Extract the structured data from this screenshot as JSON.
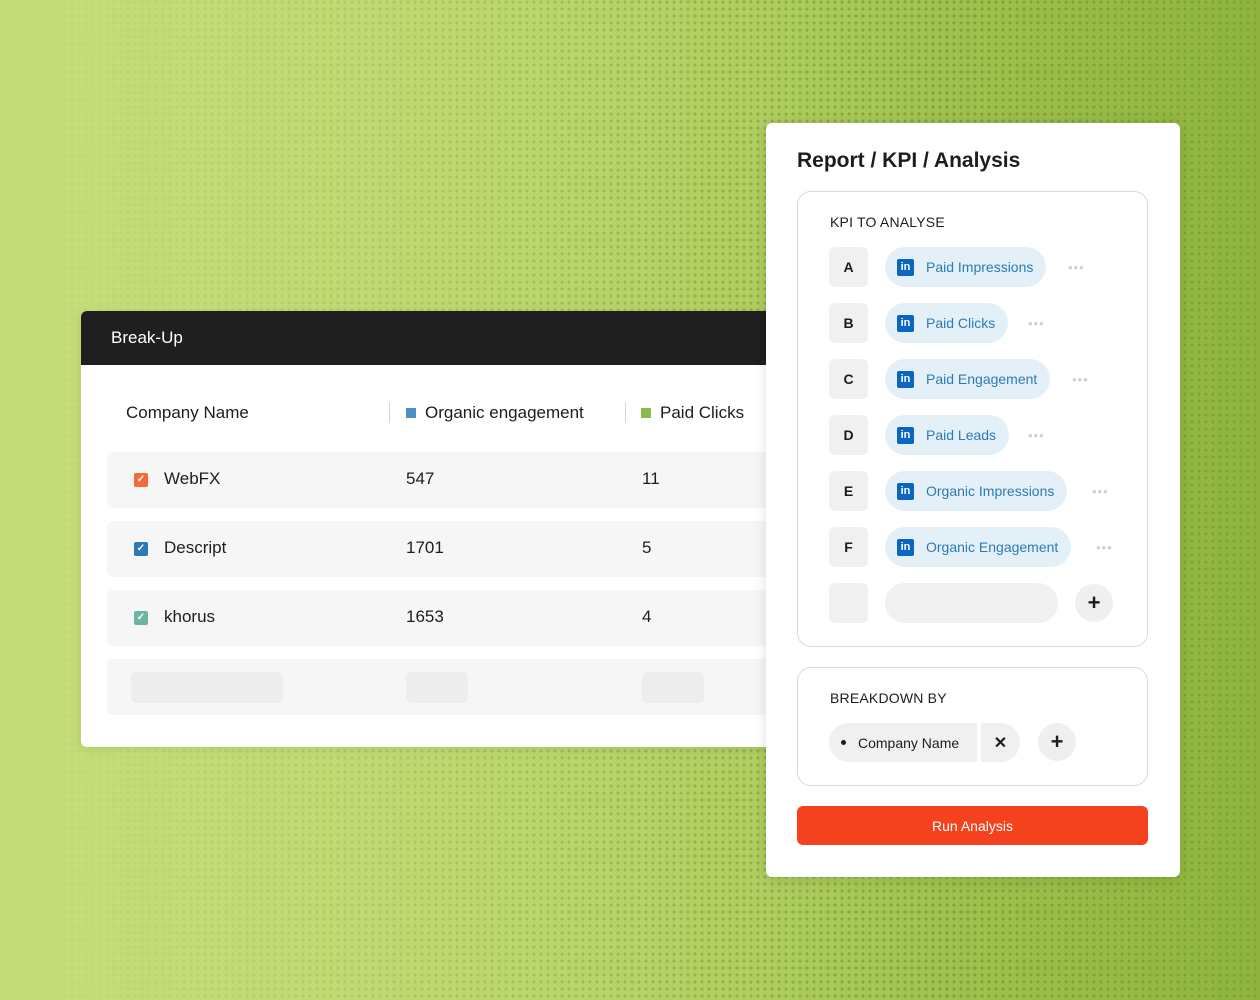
{
  "breakup": {
    "title": "Break-Up",
    "columns": [
      {
        "label": "Company Name",
        "color": ""
      },
      {
        "label": "Organic engagement",
        "color": "#4a90c2"
      },
      {
        "label": "Paid Clicks",
        "color": "#8db84a"
      }
    ],
    "rows": [
      {
        "company": "WebFX",
        "organic": "547",
        "paid_clicks": "11",
        "checkbox_color": "#f26b3a",
        "checked": true
      },
      {
        "company": "Descript",
        "organic": "1701",
        "paid_clicks": "5",
        "checkbox_color": "#2e79b3",
        "checked": true
      },
      {
        "company": "khorus",
        "organic": "1653",
        "paid_clicks": "4",
        "checkbox_color": "#6fb3a3",
        "checked": true
      }
    ]
  },
  "report": {
    "title": "Report / KPI / Analysis",
    "kpi_label": "KPI TO ANALYSE",
    "kpis": [
      {
        "letter": "A",
        "label": "Paid Impressions",
        "icon": "linkedin-icon"
      },
      {
        "letter": "B",
        "label": "Paid Clicks",
        "icon": "linkedin-icon"
      },
      {
        "letter": "C",
        "label": "Paid Engagement",
        "icon": "linkedin-icon"
      },
      {
        "letter": "D",
        "label": "Paid Leads",
        "icon": "linkedin-icon"
      },
      {
        "letter": "E",
        "label": "Organic Impressions",
        "icon": "linkedin-icon"
      },
      {
        "letter": "F",
        "label": "Organic Engagement",
        "icon": "linkedin-icon"
      }
    ],
    "add_kpi_icon": "plus-icon",
    "breakdown_label": "BREAKDOWN BY",
    "breakdown_value": "Company Name",
    "remove_icon": "close-icon",
    "add_breakdown_icon": "plus-icon",
    "run_label": "Run Analysis",
    "accent_color": "#f4421f"
  }
}
